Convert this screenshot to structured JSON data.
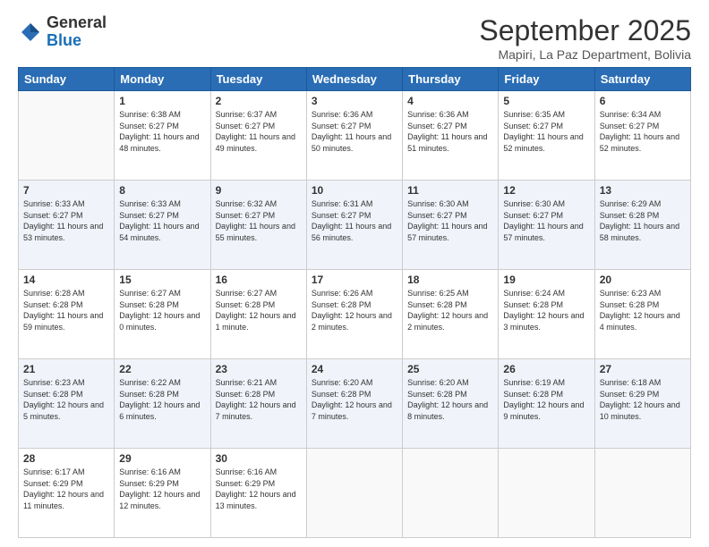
{
  "header": {
    "logo_general": "General",
    "logo_blue": "Blue",
    "month_title": "September 2025",
    "location": "Mapiri, La Paz Department, Bolivia"
  },
  "calendar": {
    "days_of_week": [
      "Sunday",
      "Monday",
      "Tuesday",
      "Wednesday",
      "Thursday",
      "Friday",
      "Saturday"
    ],
    "weeks": [
      [
        {
          "day": "",
          "sunrise": "",
          "sunset": "",
          "daylight": "",
          "empty": true
        },
        {
          "day": "1",
          "sunrise": "Sunrise: 6:38 AM",
          "sunset": "Sunset: 6:27 PM",
          "daylight": "Daylight: 11 hours and 48 minutes."
        },
        {
          "day": "2",
          "sunrise": "Sunrise: 6:37 AM",
          "sunset": "Sunset: 6:27 PM",
          "daylight": "Daylight: 11 hours and 49 minutes."
        },
        {
          "day": "3",
          "sunrise": "Sunrise: 6:36 AM",
          "sunset": "Sunset: 6:27 PM",
          "daylight": "Daylight: 11 hours and 50 minutes."
        },
        {
          "day": "4",
          "sunrise": "Sunrise: 6:36 AM",
          "sunset": "Sunset: 6:27 PM",
          "daylight": "Daylight: 11 hours and 51 minutes."
        },
        {
          "day": "5",
          "sunrise": "Sunrise: 6:35 AM",
          "sunset": "Sunset: 6:27 PM",
          "daylight": "Daylight: 11 hours and 52 minutes."
        },
        {
          "day": "6",
          "sunrise": "Sunrise: 6:34 AM",
          "sunset": "Sunset: 6:27 PM",
          "daylight": "Daylight: 11 hours and 52 minutes."
        }
      ],
      [
        {
          "day": "7",
          "sunrise": "Sunrise: 6:33 AM",
          "sunset": "Sunset: 6:27 PM",
          "daylight": "Daylight: 11 hours and 53 minutes."
        },
        {
          "day": "8",
          "sunrise": "Sunrise: 6:33 AM",
          "sunset": "Sunset: 6:27 PM",
          "daylight": "Daylight: 11 hours and 54 minutes."
        },
        {
          "day": "9",
          "sunrise": "Sunrise: 6:32 AM",
          "sunset": "Sunset: 6:27 PM",
          "daylight": "Daylight: 11 hours and 55 minutes."
        },
        {
          "day": "10",
          "sunrise": "Sunrise: 6:31 AM",
          "sunset": "Sunset: 6:27 PM",
          "daylight": "Daylight: 11 hours and 56 minutes."
        },
        {
          "day": "11",
          "sunrise": "Sunrise: 6:30 AM",
          "sunset": "Sunset: 6:27 PM",
          "daylight": "Daylight: 11 hours and 57 minutes."
        },
        {
          "day": "12",
          "sunrise": "Sunrise: 6:30 AM",
          "sunset": "Sunset: 6:27 PM",
          "daylight": "Daylight: 11 hours and 57 minutes."
        },
        {
          "day": "13",
          "sunrise": "Sunrise: 6:29 AM",
          "sunset": "Sunset: 6:28 PM",
          "daylight": "Daylight: 11 hours and 58 minutes."
        }
      ],
      [
        {
          "day": "14",
          "sunrise": "Sunrise: 6:28 AM",
          "sunset": "Sunset: 6:28 PM",
          "daylight": "Daylight: 11 hours and 59 minutes."
        },
        {
          "day": "15",
          "sunrise": "Sunrise: 6:27 AM",
          "sunset": "Sunset: 6:28 PM",
          "daylight": "Daylight: 12 hours and 0 minutes."
        },
        {
          "day": "16",
          "sunrise": "Sunrise: 6:27 AM",
          "sunset": "Sunset: 6:28 PM",
          "daylight": "Daylight: 12 hours and 1 minute."
        },
        {
          "day": "17",
          "sunrise": "Sunrise: 6:26 AM",
          "sunset": "Sunset: 6:28 PM",
          "daylight": "Daylight: 12 hours and 2 minutes."
        },
        {
          "day": "18",
          "sunrise": "Sunrise: 6:25 AM",
          "sunset": "Sunset: 6:28 PM",
          "daylight": "Daylight: 12 hours and 2 minutes."
        },
        {
          "day": "19",
          "sunrise": "Sunrise: 6:24 AM",
          "sunset": "Sunset: 6:28 PM",
          "daylight": "Daylight: 12 hours and 3 minutes."
        },
        {
          "day": "20",
          "sunrise": "Sunrise: 6:23 AM",
          "sunset": "Sunset: 6:28 PM",
          "daylight": "Daylight: 12 hours and 4 minutes."
        }
      ],
      [
        {
          "day": "21",
          "sunrise": "Sunrise: 6:23 AM",
          "sunset": "Sunset: 6:28 PM",
          "daylight": "Daylight: 12 hours and 5 minutes."
        },
        {
          "day": "22",
          "sunrise": "Sunrise: 6:22 AM",
          "sunset": "Sunset: 6:28 PM",
          "daylight": "Daylight: 12 hours and 6 minutes."
        },
        {
          "day": "23",
          "sunrise": "Sunrise: 6:21 AM",
          "sunset": "Sunset: 6:28 PM",
          "daylight": "Daylight: 12 hours and 7 minutes."
        },
        {
          "day": "24",
          "sunrise": "Sunrise: 6:20 AM",
          "sunset": "Sunset: 6:28 PM",
          "daylight": "Daylight: 12 hours and 7 minutes."
        },
        {
          "day": "25",
          "sunrise": "Sunrise: 6:20 AM",
          "sunset": "Sunset: 6:28 PM",
          "daylight": "Daylight: 12 hours and 8 minutes."
        },
        {
          "day": "26",
          "sunrise": "Sunrise: 6:19 AM",
          "sunset": "Sunset: 6:28 PM",
          "daylight": "Daylight: 12 hours and 9 minutes."
        },
        {
          "day": "27",
          "sunrise": "Sunrise: 6:18 AM",
          "sunset": "Sunset: 6:29 PM",
          "daylight": "Daylight: 12 hours and 10 minutes."
        }
      ],
      [
        {
          "day": "28",
          "sunrise": "Sunrise: 6:17 AM",
          "sunset": "Sunset: 6:29 PM",
          "daylight": "Daylight: 12 hours and 11 minutes."
        },
        {
          "day": "29",
          "sunrise": "Sunrise: 6:16 AM",
          "sunset": "Sunset: 6:29 PM",
          "daylight": "Daylight: 12 hours and 12 minutes."
        },
        {
          "day": "30",
          "sunrise": "Sunrise: 6:16 AM",
          "sunset": "Sunset: 6:29 PM",
          "daylight": "Daylight: 12 hours and 13 minutes."
        },
        {
          "day": "",
          "sunrise": "",
          "sunset": "",
          "daylight": "",
          "empty": true
        },
        {
          "day": "",
          "sunrise": "",
          "sunset": "",
          "daylight": "",
          "empty": true
        },
        {
          "day": "",
          "sunrise": "",
          "sunset": "",
          "daylight": "",
          "empty": true
        },
        {
          "day": "",
          "sunrise": "",
          "sunset": "",
          "daylight": "",
          "empty": true
        }
      ]
    ]
  }
}
